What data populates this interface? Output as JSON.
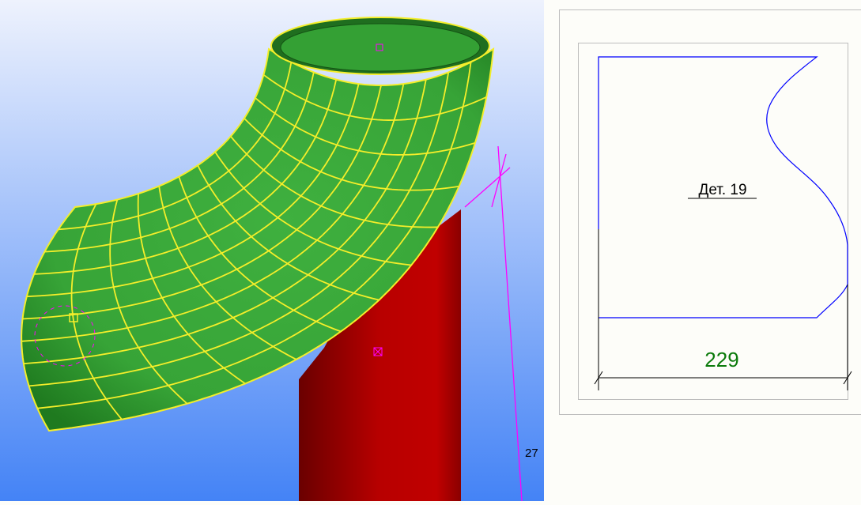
{
  "viewport3d": {
    "dimension_label": "27",
    "colors": {
      "sky_top": "#eef2fd",
      "sky_bottom": "#4483f6",
      "elbow": "#3aa83a",
      "grid": "#f4ee2a",
      "pipe": "#b30000",
      "marker": "#ff00ff"
    }
  },
  "drawing": {
    "part_label": "Дет. 19",
    "dimension_value": "229",
    "colors": {
      "contour": "#0000ff",
      "dimension_text": "#0a7a0a",
      "frame": "#bdbdbd"
    }
  }
}
